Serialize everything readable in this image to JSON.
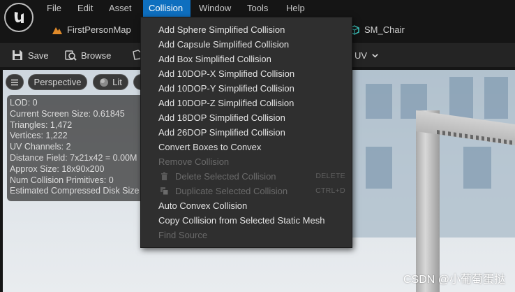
{
  "menubar": {
    "items": [
      "File",
      "Edit",
      "Asset",
      "Collision",
      "Window",
      "Tools",
      "Help"
    ],
    "active": "Collision"
  },
  "tabs": [
    {
      "label": "FirstPersonMap",
      "icon": "level-icon"
    },
    {
      "label": "SM_Chair",
      "icon": "static-mesh-icon"
    }
  ],
  "toolbar": {
    "save_label": "Save",
    "browse_label": "Browse",
    "uv_label": "UV"
  },
  "viewport": {
    "perspective_label": "Perspective",
    "lit_label": "Lit",
    "stats": [
      "LOD:  0",
      "Current Screen Size:  0.61845",
      "Triangles:  1,472",
      "Vertices:  1,222",
      "UV Channels:  2",
      "Distance Field:  7x21x42 = 0.00M",
      "Approx Size: 18x90x200",
      "Num Collision Primitives:  0",
      "Estimated Compressed Disk Size"
    ]
  },
  "collision_menu": {
    "items": [
      {
        "label": "Add Sphere Simplified Collision",
        "enabled": true
      },
      {
        "label": "Add Capsule Simplified Collision",
        "enabled": true
      },
      {
        "label": "Add Box Simplified Collision",
        "enabled": true
      },
      {
        "label": "Add 10DOP-X Simplified Collision",
        "enabled": true
      },
      {
        "label": "Add 10DOP-Y Simplified Collision",
        "enabled": true
      },
      {
        "label": "Add 10DOP-Z Simplified Collision",
        "enabled": true
      },
      {
        "label": "Add 18DOP Simplified Collision",
        "enabled": true
      },
      {
        "label": "Add 26DOP Simplified Collision",
        "enabled": true
      },
      {
        "label": "Convert Boxes to Convex",
        "enabled": true
      },
      {
        "label": "Remove Collision",
        "enabled": false
      },
      {
        "label": "Delete Selected Collision",
        "enabled": false,
        "shortcut": "DELETE",
        "icon": "trash-icon"
      },
      {
        "label": "Duplicate Selected Collision",
        "enabled": false,
        "shortcut": "CTRL+D",
        "icon": "duplicate-icon"
      },
      {
        "label": "Auto Convex Collision",
        "enabled": true
      },
      {
        "label": "Copy Collision from Selected Static Mesh",
        "enabled": true
      },
      {
        "label": "Find Source",
        "enabled": false
      }
    ]
  },
  "watermark": "CSDN @小葡萄蛋挞",
  "colors": {
    "accent": "#0e6fbf",
    "menu_bg": "#2f2f2f",
    "disabled_text": "#6a6a6a"
  }
}
